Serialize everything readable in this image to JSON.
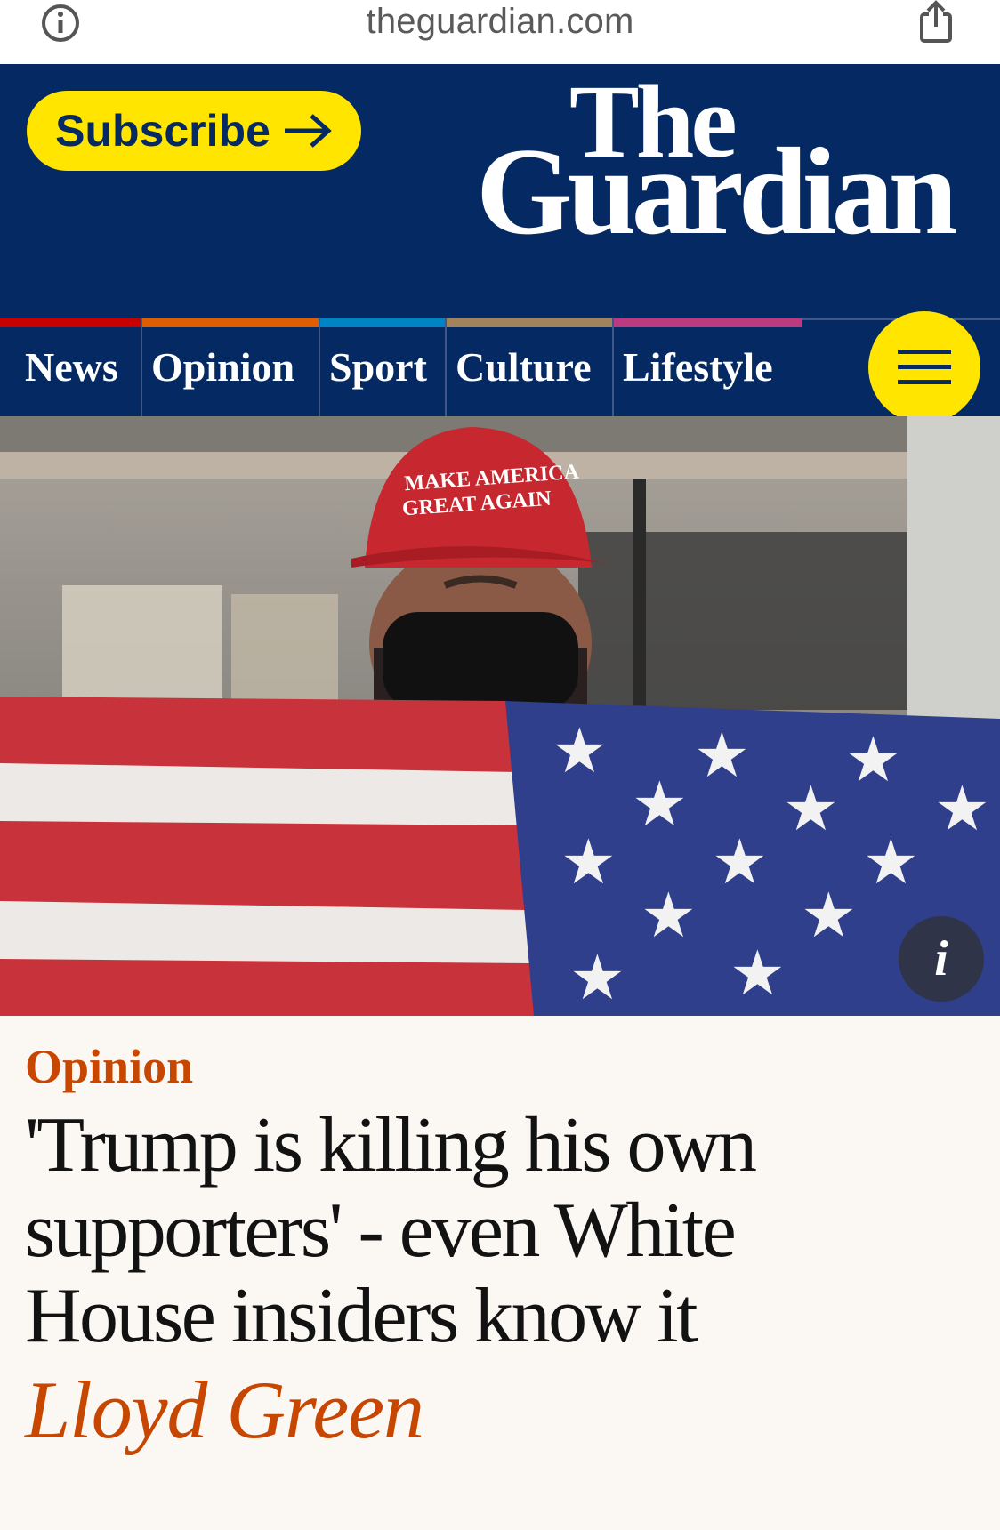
{
  "browser": {
    "domain": "theguardian.com",
    "info_icon": "info-circle-icon",
    "share_icon": "share-icon"
  },
  "masthead": {
    "subscribe_label": "Subscribe",
    "subscribe_icon": "arrow-right-icon",
    "logo_line1": "The",
    "logo_line2": "Guardian",
    "background_color": "#052962",
    "accent_color": "#ffe500"
  },
  "nav": {
    "items": [
      {
        "label": "News",
        "color": "#c70000"
      },
      {
        "label": "Opinion",
        "color": "#e05e00"
      },
      {
        "label": "Sport",
        "color": "#0084c6"
      },
      {
        "label": "Culture",
        "color": "#a1845c"
      },
      {
        "label": "Lifestyle",
        "color": "#bb3b80"
      }
    ],
    "menu_icon": "hamburger-menu-icon"
  },
  "hero": {
    "cap_text_line1": "MAKE AMERICA",
    "cap_text_line2": "GREAT AGAIN",
    "info_button_label": "i"
  },
  "article": {
    "kicker": "Opinion",
    "headline_line1": "'Trump is killing his own",
    "headline_line2": "supporters' - even White",
    "headline_line3": "House insiders know it",
    "byline": "Lloyd Green",
    "kicker_color": "#c74600"
  }
}
